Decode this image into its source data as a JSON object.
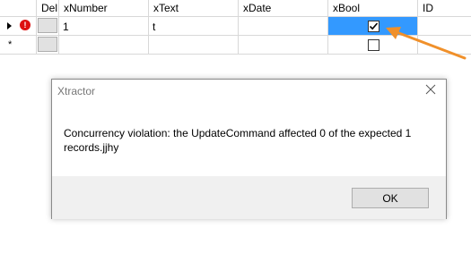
{
  "grid": {
    "columns": [
      "Del",
      "xNumber",
      "xText",
      "xDate",
      "xBool",
      "ID"
    ],
    "rows": [
      {
        "xNumber": "1",
        "xText": "t",
        "xDate": "",
        "xBool_checked": true,
        "ID": ""
      }
    ],
    "new_row_marker": "*",
    "error_mark": "!"
  },
  "dialog": {
    "title": "Xtractor",
    "message": "Concurrency violation: the UpdateCommand affected 0 of the expected 1 records.jjhy",
    "ok_label": "OK"
  },
  "colors": {
    "selection": "#3399ff",
    "annotation_arrow": "#f0902a",
    "error": "#d11111"
  }
}
